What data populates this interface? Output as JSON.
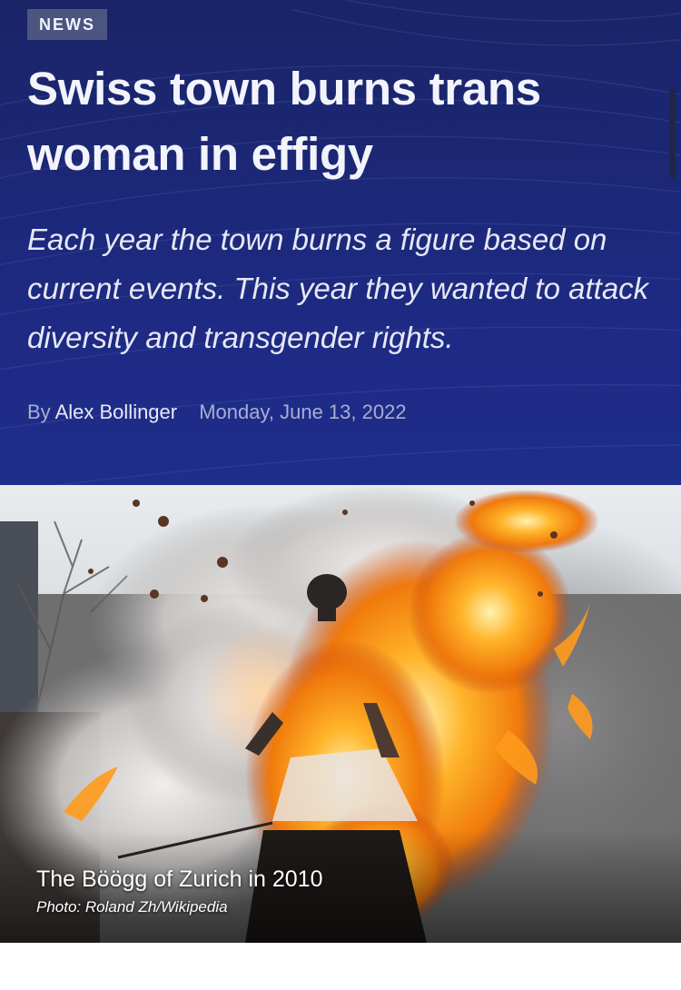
{
  "article": {
    "category": "NEWS",
    "headline": "Swiss town burns trans woman in effigy",
    "dek": "Each year the town burns a figure based on current events. This year they wanted to attack diversity and transgender rights.",
    "byline_prefix": "By",
    "author": "Alex Bollinger",
    "date": "Monday, June 13, 2022"
  },
  "photo": {
    "caption": "The Böögg of Zurich in 2010",
    "credit": "Photo: Roland Zh/Wikipedia"
  },
  "colors": {
    "header_bg": "#1c2878",
    "badge_bg": "#4c5480",
    "flame": "#f08a10"
  }
}
